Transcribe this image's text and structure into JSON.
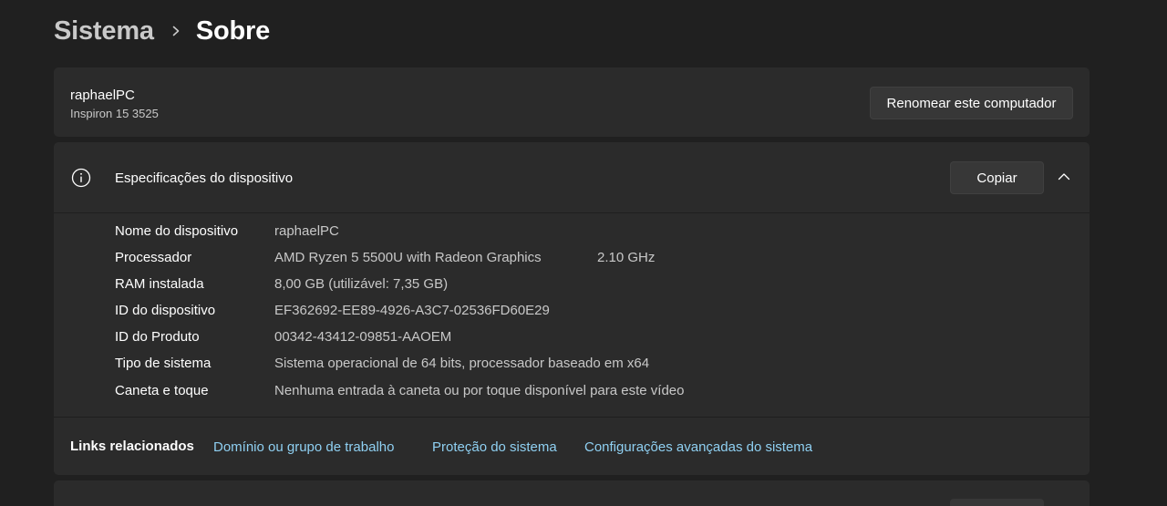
{
  "breadcrumb": {
    "parent": "Sistema",
    "current": "Sobre"
  },
  "device": {
    "name": "raphaelPC",
    "model": "Inspiron 15 3525",
    "rename_button": "Renomear este computador"
  },
  "specs": {
    "title": "Especificações do dispositivo",
    "copy_button": "Copiar",
    "rows": [
      {
        "label": "Nome do dispositivo",
        "value": "raphaelPC"
      },
      {
        "label": "Processador",
        "value": "AMD Ryzen 5 5500U with Radeon Graphics",
        "extra": "2.10 GHz"
      },
      {
        "label": "RAM instalada",
        "value": "8,00 GB (utilizável: 7,35 GB)"
      },
      {
        "label": "ID do dispositivo",
        "value": "EF362692-EE89-4926-A3C7-02536FD60E29"
      },
      {
        "label": "ID do Produto",
        "value": "00342-43412-09851-AAOEM"
      },
      {
        "label": "Tipo de sistema",
        "value": "Sistema operacional de 64 bits, processador baseado em x64"
      },
      {
        "label": "Caneta e toque",
        "value": "Nenhuma entrada à caneta ou por toque disponível para este vídeo"
      }
    ]
  },
  "related_links": {
    "title": "Links relacionados",
    "links": [
      "Domínio ou grupo de trabalho",
      "Proteção do sistema",
      "Configurações avançadas do sistema"
    ]
  },
  "colors": {
    "background": "#202020",
    "card": "#2b2b2b",
    "link": "#8fd0f2"
  }
}
